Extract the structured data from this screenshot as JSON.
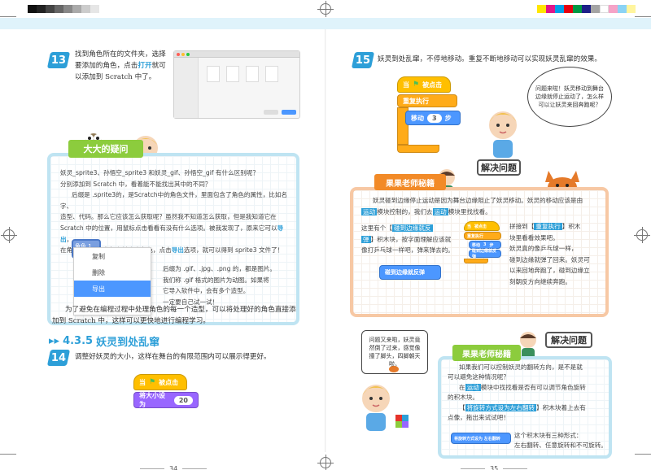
{
  "colors": {
    "accent_blue": "#2d9fd8",
    "green_label": "#8ccc3d",
    "orange_label": "#f28a27",
    "scratch_event": "#ffbf00",
    "scratch_motion": "#4c97ff",
    "scratch_looks": "#9966ff",
    "scratch_control": "#ffab19"
  },
  "left": {
    "step13": {
      "number": "13",
      "line1": "找到角色所在的文件夹，选择",
      "line2_a": "要添加的角色，点击",
      "line2_hl": "打开",
      "line2_b": "就可",
      "line3": "以添加到 Scratch 中了。"
    },
    "panel": {
      "label": "大大的疑问",
      "q1": "妖灵_sprite3、孙悟空_sprite3 和妖灵_gif、孙悟空_gif 有什么区别呢？",
      "q2": "分别添加到 Scratch 中，看着能不能找出其中的不同？",
      "p1": "后缀是 .sprite3的，是Scratch中的角色文件，里面包含了角色的属性，比如名字、",
      "p2": "造型、代码。那么它应该怎么获取呢？虽然我不知道怎么获取，但是我知道它在",
      "p3_a": "Scratch 中的位置，用鼠标点击看看有没有什么选项。被我发现了，原来它可以",
      "p3_hl": "导出",
      "p3_b": "，",
      "p4_a": "在角色列表中用鼠标右键点击角色，点击",
      "p4_hl": "导出",
      "p4_b": "选项，就可以得到 sprite3 文件了！",
      "sprite_tab": "角色 1",
      "menu": [
        "复制",
        "删除",
        "导出"
      ],
      "r1": "后缀为 .gif、.jpg、.png 的，都是图片。",
      "r2": "我们称 .gif 格式的图片为动图。如果将",
      "r3": "它导入软件中，会有多个造型。",
      "r4": "一定要自己试一试！"
    },
    "para1": "为了避免在编程过程中处理角色的每一个造型，可以将处理好的角色直接添",
    "para2": "加到 Scratch 中，这样可以更快地进行编程学习。",
    "section": {
      "arrows": "▸▸",
      "number": "4.3.5",
      "title": "妖灵到处乱窜"
    },
    "step14": {
      "number": "14",
      "text": "调整好妖灵的大小，这样在舞台的有限范围内可以展示得更好。"
    },
    "blocks14": {
      "when": "当",
      "flag": "⚑",
      "clicked": "被点击",
      "setsize": "将大小设为",
      "value": "20"
    },
    "page_number": "34"
  },
  "right": {
    "step15": {
      "number": "15",
      "text": "妖灵到处乱窜，不停地移动。重复不断地移动可以实现妖灵乱窜的效果。"
    },
    "blocks15": {
      "when": "当",
      "flag": "⚑",
      "clicked": "被点击",
      "forever": "重复执行",
      "move": "移动",
      "steps_value": "3",
      "steps": "步"
    },
    "bubble1": "问题来啦！妖灵移动到舞台边缘就停止运动了，怎么样可以让妖灵来回奔跑呢？",
    "solve_label": "解决问题",
    "tip1": {
      "label": "果果老师秘籍",
      "l1": "妖灵碰到边缘停止运动是因为舞台边缘阻止了妖灵移动。妖灵的移动应该是由",
      "l2_tag": "运动",
      "l2_a": "模块控制的，我们去",
      "l2_tag2": "运动",
      "l2_b": "模块里找找看。",
      "a1": "这里有个【",
      "a1_tag": "碰到边缘就反",
      "a2_tag": "弹",
      "a2": "】积木块，按字面理解应该就",
      "a3": "像打乒乓球一样吧，弹来弹去的。",
      "bounce": "碰到边缘就反弹",
      "b1_a": "拼接到【",
      "b1_tag": "重复执行",
      "b1_b": "】积木",
      "b2": "块里看看效果吧。",
      "b3": "妖灵真的像乒乓球一样，",
      "b4": "碰到边缘就弹了回来。妖灵可",
      "b5": "以来回地奔跑了，碰到边缘立",
      "b6": "刻朝反方向继续奔跑。"
    },
    "bubble2": "问题又来啦，妖灵竟然倒了过来，感觉像撞了脚头，四脚朝天啦。",
    "tip2": {
      "label": "果果老师秘籍",
      "l1": "如果我们可以控制妖灵的翻转方向，是不是就",
      "l2": "可以避免这种情况呢？",
      "l3_a": "在",
      "l3_tag": "运动",
      "l3_b": "模块中找找看是否有可以调节角色旋转",
      "l4": "的积木块。",
      "l5_a": "【",
      "l5_tag": "将旋转方式设为左右翻转",
      "l5_b": "】积木块着上去有",
      "l6": "点像，拖出来试试吧！",
      "rot_block": "将旋转方式设为 左右翻转",
      "l7": "这个积木块有三种形式：",
      "l8": "左右翻转、任意旋转和不可旋转。"
    },
    "page_number": "35"
  }
}
